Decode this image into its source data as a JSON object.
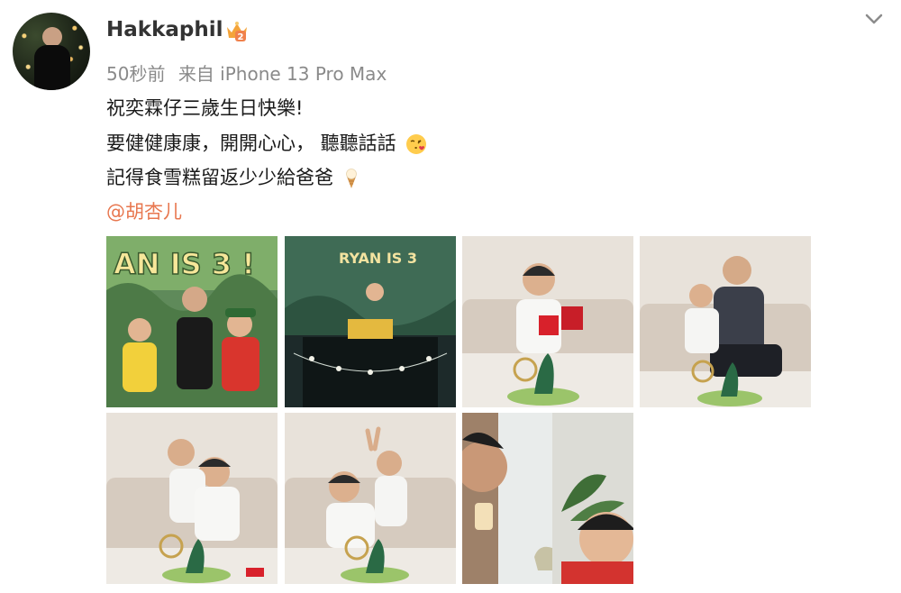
{
  "post": {
    "username": "Hakkaphil",
    "time_ago": "50秒前",
    "source": "来自 iPhone 13 Pro Max",
    "lines": [
      "祝奕霖仔三歲生日快樂!",
      "要健健康康，開開心心， 聽聽話話",
      "記得食雪糕留返少少給爸爸"
    ],
    "mention": "@胡杏儿",
    "photos": [
      {
        "caption": "AN IS 3 !"
      },
      {
        "caption": "RYAN IS 3"
      },
      {
        "caption": ""
      },
      {
        "caption": ""
      },
      {
        "caption": ""
      },
      {
        "caption": ""
      },
      {
        "caption": ""
      }
    ]
  },
  "icons": [
    "avatar",
    "vip-crown-icon",
    "chevron-down-icon",
    "kissing-face-emoji",
    "ice-cream-emoji"
  ],
  "colors": {
    "mention": "#e8774f",
    "meta": "#8a8a8a",
    "username": "#333333"
  }
}
